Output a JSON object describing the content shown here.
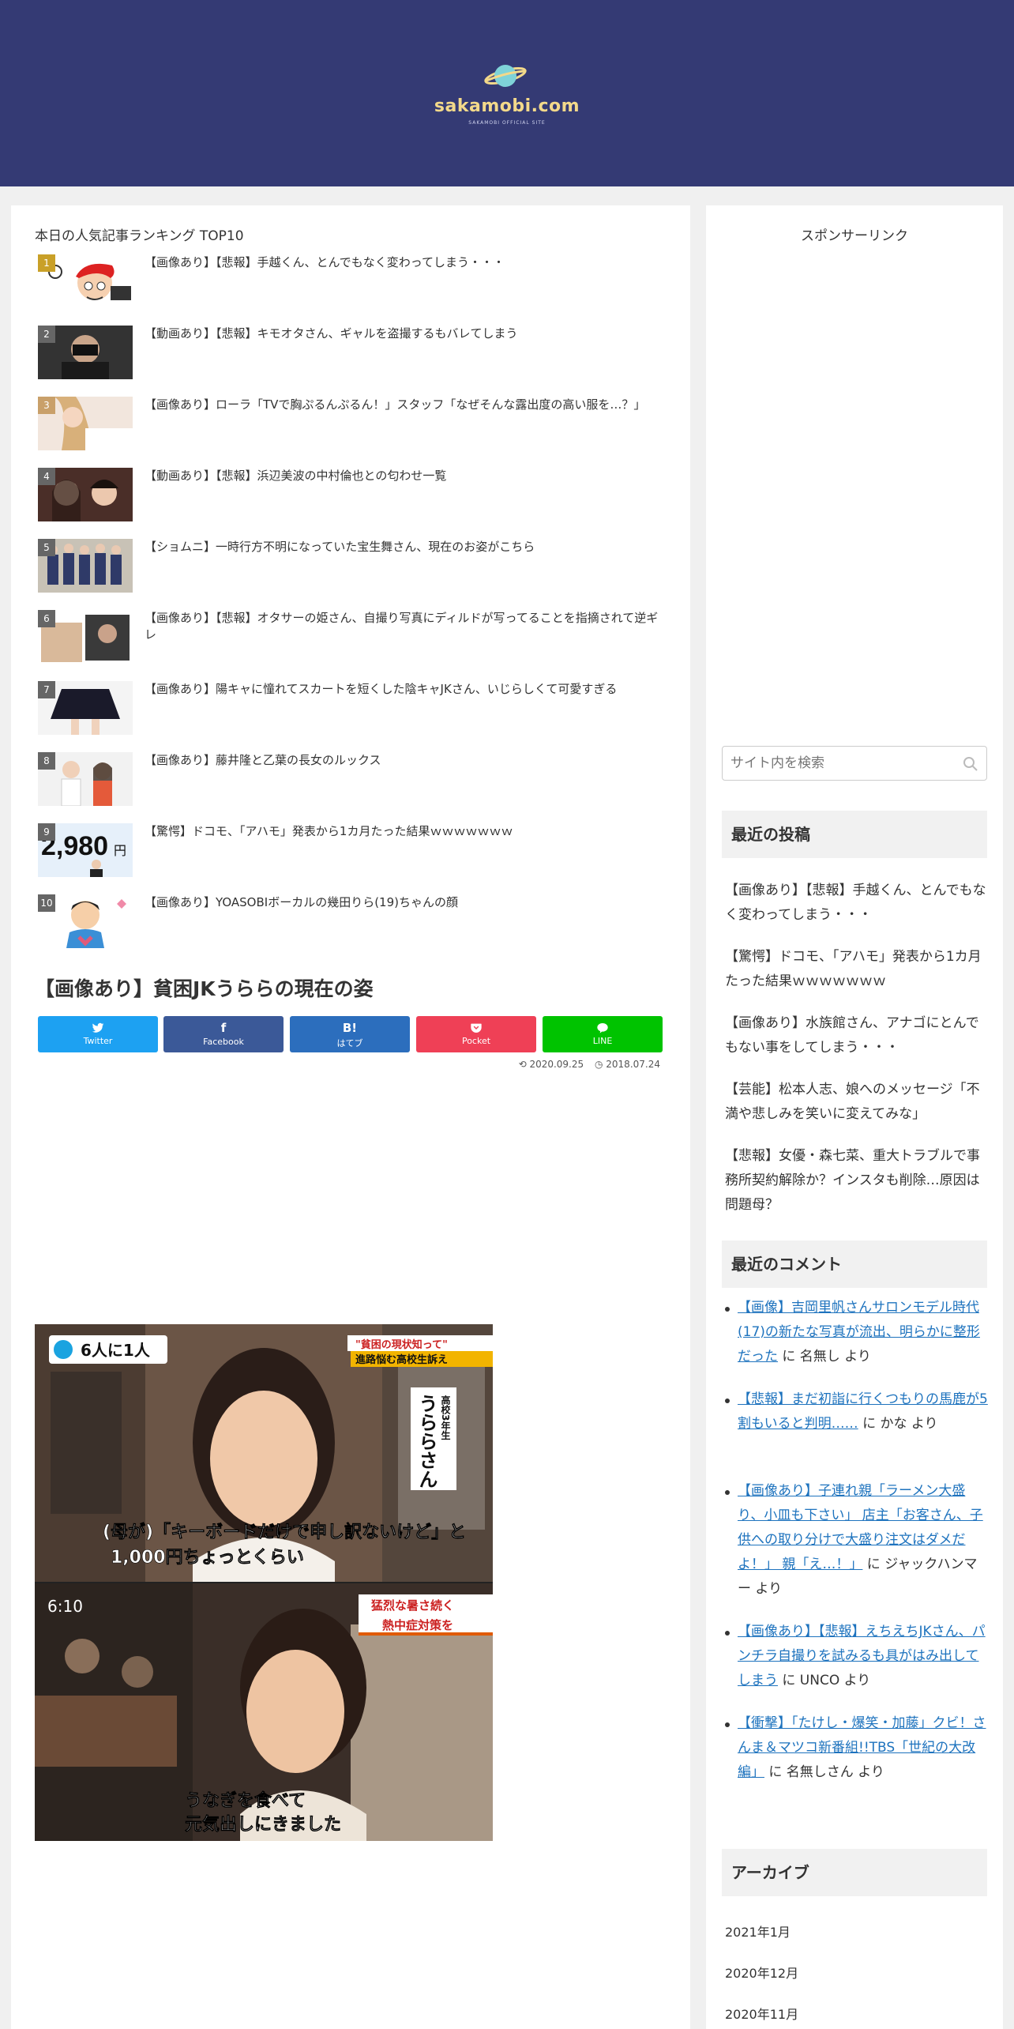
{
  "header": {
    "site_name": "sakamobi.com",
    "tagline": "SAKAMOBI OFFICIAL SITE",
    "bg_color": "#343a74"
  },
  "ranking": {
    "title": "本日の人気記事ランキング TOP10",
    "items": [
      {
        "rank": "1",
        "text": "【画像あり】【悲報】手越くん、とんでもなく変わってしまう・・・"
      },
      {
        "rank": "2",
        "text": "【動画あり】【悲報】キモオタさん、ギャルを盗撮するもバレてしまう"
      },
      {
        "rank": "3",
        "text": "【画像あり】ローラ「TVで胸ぷるんぷるん！」スタッフ「なぜそんな露出度の高い服を…？」"
      },
      {
        "rank": "4",
        "text": "【動画あり】【悲報】浜辺美波の中村倫也との匂わせ一覧"
      },
      {
        "rank": "5",
        "text": "【ショムニ】一時行方不明になっていた宝生舞さん、現在のお姿がこちら"
      },
      {
        "rank": "6",
        "text": "【画像あり】【悲報】オタサーの姫さん、自撮り写真にディルドが写ってることを指摘されて逆ギレ"
      },
      {
        "rank": "7",
        "text": "【画像あり】陽キャに憧れてスカートを短くした陰キャJKさん、いじらしくて可愛すぎる"
      },
      {
        "rank": "8",
        "text": "【画像あり】藤井隆と乙葉の長女のルックス"
      },
      {
        "rank": "9",
        "text": "【驚愕】ドコモ、「アハモ」発表から1カ月たった結果ｗｗｗｗｗｗｗ"
      },
      {
        "rank": "10",
        "text": "【画像あり】YOASOBIボーカルの幾田りら(19)ちゃんの顔"
      }
    ]
  },
  "thumb_text": {
    "price": "2,980",
    "yen": "円"
  },
  "article": {
    "title": "【画像あり】貧困JKうららの現在の姿",
    "updated": "2020.09.25",
    "published": "2018.07.24"
  },
  "share": {
    "twitter": {
      "label": "Twitter",
      "icon": "twitter-bird",
      "color": "#1da1f2"
    },
    "facebook": {
      "label": "Facebook",
      "icon": "f",
      "color": "#3b5998"
    },
    "hatebu": {
      "label": "はてブ",
      "icon": "B!",
      "color": "#2c6ebd"
    },
    "pocket": {
      "label": "Pocket",
      "icon": "pocket",
      "color": "#ef4056"
    },
    "line": {
      "label": "LINE",
      "icon": "line",
      "color": "#00c300"
    }
  },
  "news_image": {
    "badge": "6人に1人",
    "banner_line1": "\"貧困の現状知って\"",
    "banner_line2": "進路悩む高校生訴え",
    "vertical_sub": "高校3年生",
    "vertical_name": "うららさん",
    "caption1_line1": "(母が)「キーボードだけで申し訳ないけど」と",
    "caption1_line2": "1,000円ちょっとくらい",
    "time": "6:10",
    "banner2_line1": "猛烈な暑さ続く",
    "banner2_line2": "熱中症対策を",
    "caption2_line1": "うなぎを食べて",
    "caption2_line2": "元気出しにきました"
  },
  "sidebar": {
    "sponsor_label": "スポンサーリンク",
    "search_placeholder": "サイト内を検索",
    "recent_posts_heading": "最近の投稿",
    "recent_posts": [
      "【画像あり】【悲報】手越くん、とんでもなく変わってしまう・・・",
      "【驚愕】ドコモ、「アハモ」発表から1カ月たった結果ｗｗｗｗｗｗｗ",
      "【画像あり】水族館さん、アナゴにとんでもない事をしてしまう・・・",
      "【芸能】松本人志、娘へのメッセージ「不満や悲しみを笑いに変えてみな」",
      "【悲報】女優・森七菜、重大トラブルで事務所契約解除か？インスタも削除…原因は問題母？"
    ],
    "recent_comments_heading": "最近のコメント",
    "recent_comments": [
      {
        "link": "【画像】吉岡里帆さんサロンモデル時代(17)の新たな写真が流出、明らかに整形だった",
        "by": " に 名無し より"
      },
      {
        "link": "【悲報】まだ初詣に行くつもりの馬鹿が5割もいると判明……",
        "by": " に かな より"
      },
      {
        "link": "【画像あり】子連れ親「ラーメン大盛り、小皿も下さい」 店主「お客さん、子供への取り分けで大盛り注文はダメだよ！」 親「え…！」",
        "by": " に ジャックハンマー より"
      },
      {
        "link": "【画像あり】【悲報】えちえちJKさん、パンチラ自撮りを試みるも具がはみ出してしまう",
        "by": " に UNCO より"
      },
      {
        "link": "【衝撃】「たけし・爆笑・加藤」クビ！さんま＆マツコ新番組!!TBS「世紀の大改編」",
        "by": " に 名無しさん より"
      }
    ],
    "archive_heading": "アーカイブ",
    "archives": [
      "2021年1月",
      "2020年12月",
      "2020年11月"
    ]
  }
}
